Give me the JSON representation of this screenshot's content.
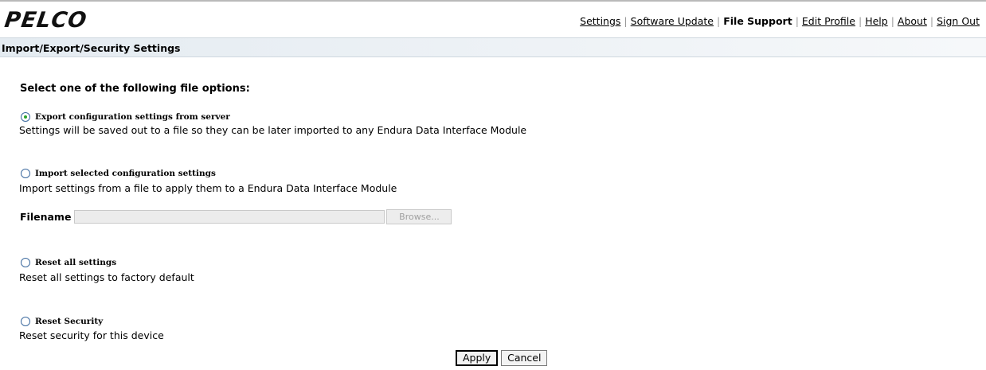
{
  "header": {
    "logo": "PELCO",
    "nav": [
      {
        "label": "Settings",
        "current": false
      },
      {
        "label": "Software Update",
        "current": false
      },
      {
        "label": "File Support",
        "current": true
      },
      {
        "label": "Edit Profile",
        "current": false
      },
      {
        "label": "Help",
        "current": false
      },
      {
        "label": "About",
        "current": false
      },
      {
        "label": "Sign Out",
        "current": false
      }
    ]
  },
  "section_title": "Import/Export/Security Settings",
  "prompt": "Select one of the following file options:",
  "options": [
    {
      "label": "Export configuration settings from server",
      "desc": "Settings will be saved out to a file so they can be later imported to any Endura Data Interface Module",
      "selected": true
    },
    {
      "label": "Import selected configuration settings",
      "desc": "Import settings from a file to apply them to a Endura Data Interface Module",
      "selected": false
    },
    {
      "label": "Reset all settings",
      "desc": "Reset all settings to factory default",
      "selected": false
    },
    {
      "label": "Reset Security",
      "desc": "Reset security for this device",
      "selected": false
    }
  ],
  "filename": {
    "label": "Filename",
    "value": "",
    "browse_label": "Browse..."
  },
  "buttons": {
    "apply": "Apply",
    "cancel": "Cancel"
  }
}
